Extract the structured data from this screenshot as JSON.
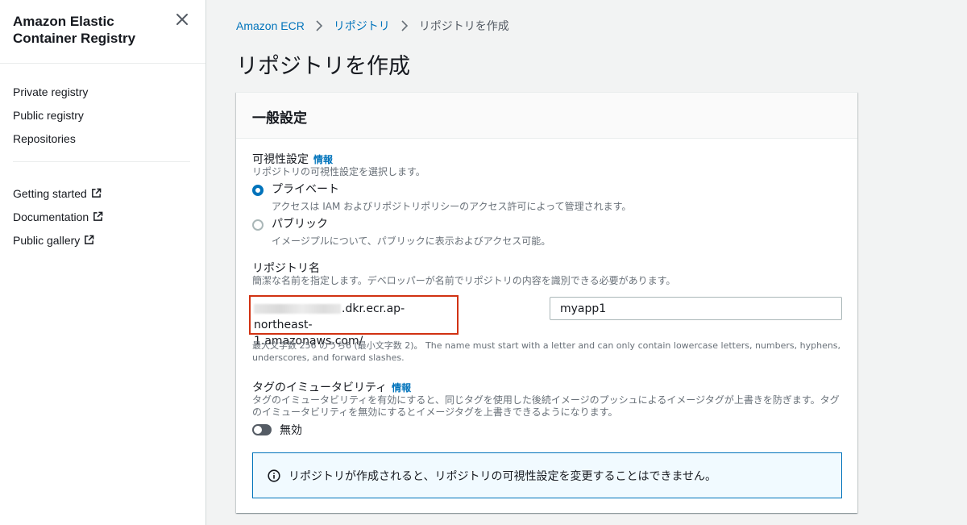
{
  "sidebar": {
    "title": "Amazon Elastic Container Registry",
    "nav": [
      {
        "label": "Private registry"
      },
      {
        "label": "Public registry"
      },
      {
        "label": "Repositories"
      }
    ],
    "links": [
      {
        "label": "Getting started",
        "icon": "external-link-icon"
      },
      {
        "label": "Documentation",
        "icon": "external-link-icon"
      },
      {
        "label": "Public gallery",
        "icon": "external-link-icon"
      }
    ]
  },
  "breadcrumb": {
    "items": [
      "Amazon ECR",
      "リポジトリ"
    ],
    "current": "リポジトリを作成"
  },
  "page_title": "リポジトリを作成",
  "panel": {
    "title": "一般設定",
    "visibility": {
      "label": "可視性設定",
      "info": "情報",
      "description": "リポジトリの可視性設定を選択します。",
      "options": [
        {
          "label": "プライベート",
          "description": "アクセスは IAM およびリポジトリポリシーのアクセス許可によって管理されます。",
          "selected": true
        },
        {
          "label": "パブリック",
          "description": "イメージプルについて、パブリックに表示およびアクセス可能。",
          "selected": false
        }
      ]
    },
    "repo_name": {
      "label": "リポジトリ名",
      "description": "簡潔な名前を指定します。デベロッパーが名前でリポジトリの内容を識別できる必要があります。",
      "uri_suffix_line1": ".dkr.ecr.ap-northeast-",
      "uri_suffix_line2": "1.amazonaws.com/",
      "value": "myapp1",
      "constraint": "最大文字数 256 のうち6 (最小文字数 2)。 The name must start with a letter and can only contain lowercase letters, numbers, hyphens, underscores, and forward slashes."
    },
    "immutability": {
      "label": "タグのイミュータビリティ",
      "info": "情報",
      "description": "タグのイミュータビリティを有効にすると、同じタグを使用した後続イメージのプッシュによるイメージタグが上書きを防ぎます。タグのイミュータビリティを無効にするとイメージタグを上書きできるようになります。",
      "toggle_label": "無効",
      "enabled": false
    },
    "alert": {
      "text": "リポジトリが作成されると、リポジトリの可視性設定を変更することはできません。",
      "icon": "info-icon"
    }
  },
  "colors": {
    "link": "#0073bb",
    "highlight_border": "#d13212",
    "alert_bg": "#f1faff"
  }
}
